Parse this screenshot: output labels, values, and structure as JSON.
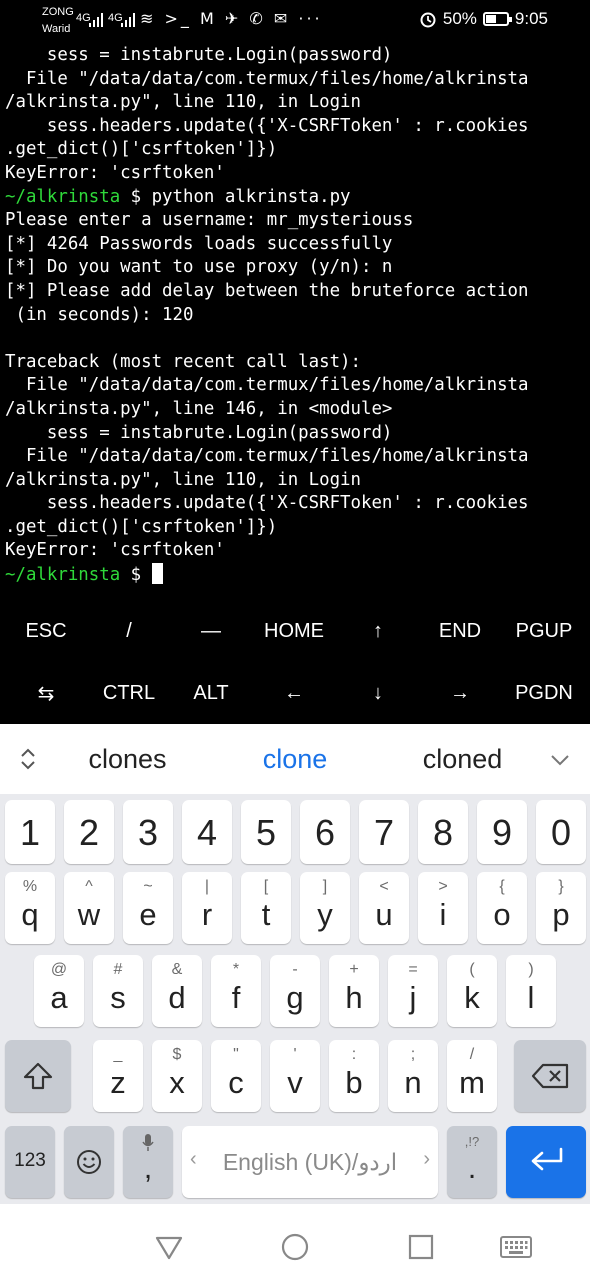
{
  "status_bar": {
    "carrier1": "ZONG",
    "carrier2": "Warid",
    "sig1": "4G",
    "sig2": "4G",
    "notif_icons": "≋ >_ M ✈ ✆ ✉ ···",
    "battery": "50%",
    "time": "9:05"
  },
  "terminal": {
    "lines": [
      "    sess = instabrute.Login(password)",
      "  File \"/data/data/com.termux/files/home/alkrinsta",
      "/alkrinsta.py\", line 110, in Login",
      "    sess.headers.update({'X-CSRFToken' : r.cookies",
      ".get_dict()['csrftoken']})",
      "KeyError: 'csrftoken'",
      "",
      "Please enter a username: mr_mysteriouss",
      "[*] 4264 Passwords loads successfully",
      "[*] Do you want to use proxy (y/n): n",
      "[*] Please add delay between the bruteforce action",
      " (in seconds): 120",
      "",
      "Traceback (most recent call last):",
      "  File \"/data/data/com.termux/files/home/alkrinsta",
      "/alkrinsta.py\", line 146, in <module>",
      "    sess = instabrute.Login(password)",
      "  File \"/data/data/com.termux/files/home/alkrinsta",
      "/alkrinsta.py\", line 110, in Login",
      "    sess.headers.update({'X-CSRFToken' : r.cookies",
      ".get_dict()['csrftoken']})",
      "KeyError: 'csrftoken'",
      ""
    ],
    "prompt1": "~/alkrinsta",
    "cmd1": " $ python alkrinsta.py",
    "prompt2": "~/alkrinsta",
    "cmd2": " $ "
  },
  "extra_keys": {
    "row1": [
      "ESC",
      "/",
      "—",
      "HOME",
      "↑",
      "END",
      "PGUP"
    ],
    "row2": [
      "⇆",
      "CTRL",
      "ALT",
      "←",
      "↓",
      "→",
      "PGDN"
    ]
  },
  "suggestions": [
    "clones",
    "clone",
    "cloned"
  ],
  "keyboard": {
    "numbers": [
      "1",
      "2",
      "3",
      "4",
      "5",
      "6",
      "7",
      "8",
      "9",
      "0"
    ],
    "row1": [
      "q",
      "w",
      "e",
      "r",
      "t",
      "y",
      "u",
      "i",
      "o",
      "p"
    ],
    "row1_sec": [
      "%",
      "^",
      "~",
      "|",
      "[",
      "]",
      "<",
      ">",
      "{",
      "}"
    ],
    "row2": [
      "a",
      "s",
      "d",
      "f",
      "g",
      "h",
      "j",
      "k",
      "l"
    ],
    "row2_sec": [
      "@",
      "#",
      "&",
      "*",
      "-",
      "+",
      "=",
      "(",
      ")"
    ],
    "row3": [
      "z",
      "x",
      "c",
      "v",
      "b",
      "n",
      "m"
    ],
    "row3_sec": [
      "_",
      "$",
      "\"",
      "'",
      ":",
      ";",
      "/"
    ],
    "sym_label": "123",
    "comma_label": ",",
    "space_label": "English (UK)/اردو",
    "period_label": ".",
    "period_sec": ",!?"
  },
  "colors": {
    "prompt_green": "#2fd93a",
    "suggestion_active": "#1a73e8",
    "enter_key": "#1a73e8"
  }
}
